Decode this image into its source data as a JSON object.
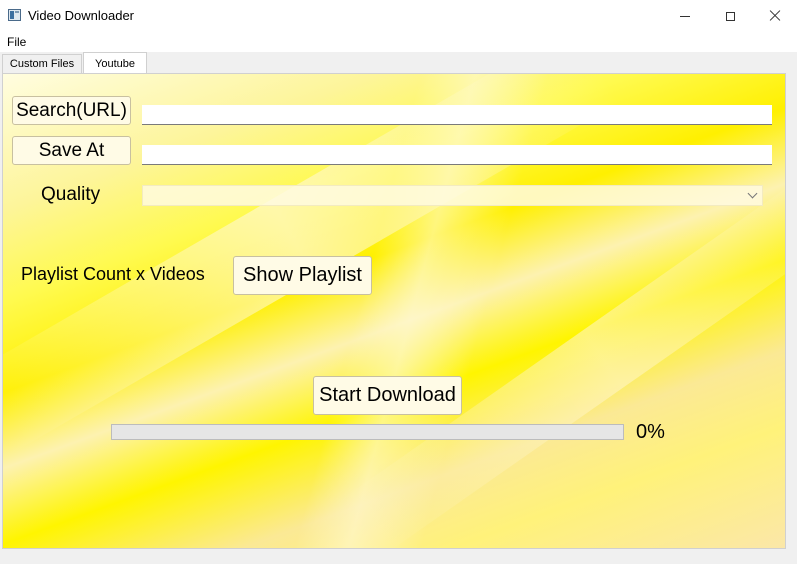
{
  "window": {
    "title": "Video Downloader"
  },
  "menu": {
    "file": "File"
  },
  "tabs": [
    {
      "label": "Custom Files",
      "active": false
    },
    {
      "label": "Youtube",
      "active": true
    }
  ],
  "youtube_tab": {
    "search_button": "Search(URL)",
    "search_value": "",
    "save_at_button": "Save At",
    "save_at_value": "",
    "quality_label": "Quality",
    "quality_selected": "",
    "playlist_count_label": "Playlist Count x Videos",
    "show_playlist_button": "Show Playlist",
    "start_download_button": "Start Download",
    "progress_text": "0%",
    "progress_value": 0
  },
  "colors": {
    "panel_yellow": "#fff000",
    "button_bg": "#fffbe6",
    "progress_fill": "#06b025"
  }
}
